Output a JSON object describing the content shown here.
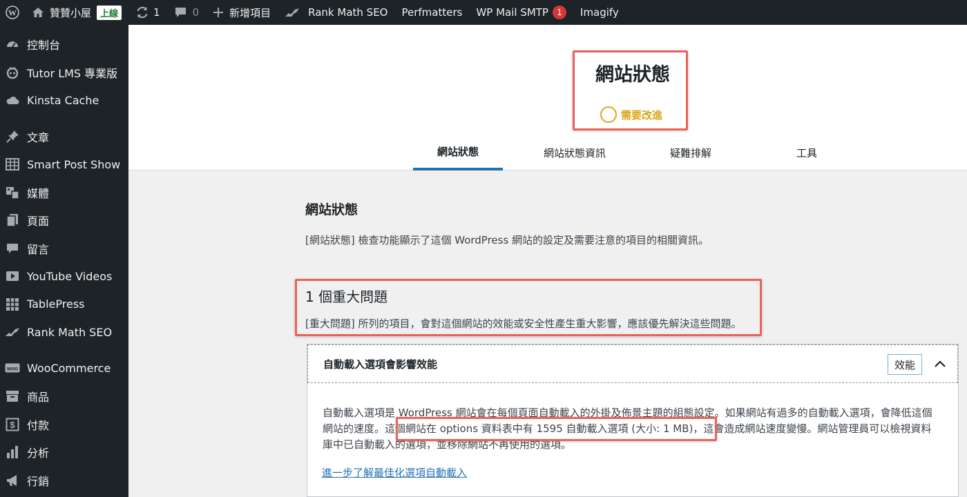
{
  "adminbar": {
    "site_name": "贊贊小屋",
    "live_badge": "上線",
    "updates_count": "1",
    "comments_count": "0",
    "new_item": "新增項目",
    "rank_math": "Rank Math SEO",
    "perfmatters": "Perfmatters",
    "wp_mail_smtp": "WP Mail SMTP",
    "wp_mail_badge": "1",
    "imagify": "Imagify"
  },
  "sidebar": {
    "items": [
      {
        "label": "控制台",
        "icon": "dashboard-icon"
      },
      {
        "label": "Tutor LMS 專業版",
        "icon": "tutor-icon"
      },
      {
        "label": "Kinsta Cache",
        "icon": "cloud-icon"
      },
      {
        "label": "文章",
        "icon": "pin-icon"
      },
      {
        "label": "Smart Post Show",
        "icon": "grid-icon"
      },
      {
        "label": "媒體",
        "icon": "media-icon"
      },
      {
        "label": "頁面",
        "icon": "page-icon"
      },
      {
        "label": "留言",
        "icon": "comment-icon"
      },
      {
        "label": "YouTube Videos",
        "icon": "video-icon"
      },
      {
        "label": "TablePress",
        "icon": "table-icon"
      },
      {
        "label": "Rank Math SEO",
        "icon": "rankmath-icon"
      },
      {
        "label": "WooCommerce",
        "icon": "woo-icon"
      },
      {
        "label": "商品",
        "icon": "archive-icon"
      },
      {
        "label": "付款",
        "icon": "payment-icon"
      },
      {
        "label": "分析",
        "icon": "chart-icon"
      },
      {
        "label": "行銷",
        "icon": "megaphone-icon"
      }
    ]
  },
  "header": {
    "title": "網站狀態",
    "status_text": "需要改進",
    "status_color": "#dba617",
    "tabs": [
      {
        "label": "網站狀態"
      },
      {
        "label": "網站狀態資訊"
      },
      {
        "label": "疑難排解"
      },
      {
        "label": "工具"
      }
    ]
  },
  "main": {
    "section_title": "網站狀態",
    "section_desc": "[網站狀態] 檢查功能顯示了這個 WordPress 網站的設定及需要注意的項目的相關資訊。",
    "issues_title": "1 個重大問題",
    "issues_desc": "[重大問題] 所列的項目，會對這個網站的效能或安全性產生重大影響，應該優先解決這些問題。",
    "accordion": {
      "title": "自動載入選項會影響效能",
      "badge": "效能",
      "body_part1": "自動載入選項是 WordPress 網站會在每個頁面自動載入的外掛及佈景主題的組態設定。如果網站有過多的自動載入選項，會降低這個網站的速度。",
      "body_highlight": "這個網站在 options 資料表中有 1595 自動載入選項 (大小: 1 MB)",
      "body_part2": "，這會造成網站速度變慢。網站管理員可以檢視資料庫中已自動載入的選項，並移除網站不再使用的選項。",
      "link": "進一步了解最佳化選項自動載入"
    }
  }
}
